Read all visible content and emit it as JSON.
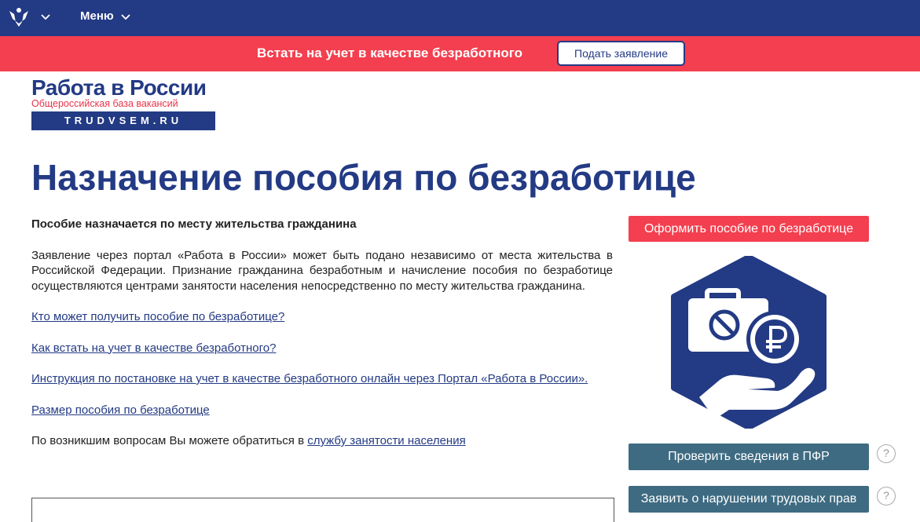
{
  "topbar": {
    "menu_label": "Меню"
  },
  "promo": {
    "text": "Встать на учет в качестве безработного",
    "button_label": "Подать заявление"
  },
  "logo": {
    "title": "Работа в России",
    "subtitle": "Общероссийская база вакансий",
    "domain": "TRUDVSEM.RU"
  },
  "page": {
    "title": "Назначение пособия по безработице"
  },
  "content": {
    "lead": "Пособие назначается по месту жительства гражданина",
    "paragraph": "Заявление через портал «Работа в России» может быть подано независимо от места жительства в Российской Федерации. Признание гражданина безработным и начисление пособия по безработице осуществляются центрами занятости населения непосредственно по месту жительства гражданина.",
    "links": [
      "Кто может получить пособие по безработице?",
      "Как встать на учет в качестве безработного?",
      "Инструкция по постановке на учет в качестве безработного онлайн через Портал «Работа в России».",
      "Размер пособия по безработице"
    ],
    "contact_prefix": "По возникшим вопросам Вы можете обратиться в ",
    "contact_link": "службу занятости населения"
  },
  "sidebar": {
    "apply_button": "Оформить пособие по безработице",
    "check_button": "Проверить сведения в ПФР",
    "report_button": "Заявить о нарушении трудовых прав",
    "help_glyph": "?"
  },
  "icons": {
    "emblem": "coat-of-arms-icon",
    "chevron": "chevron-down-icon",
    "illustration": "benefit-hand-ruble-icon"
  },
  "colors": {
    "brand_blue": "#233a84",
    "accent_red": "#f33f4f",
    "button_teal": "#3e6b82"
  }
}
